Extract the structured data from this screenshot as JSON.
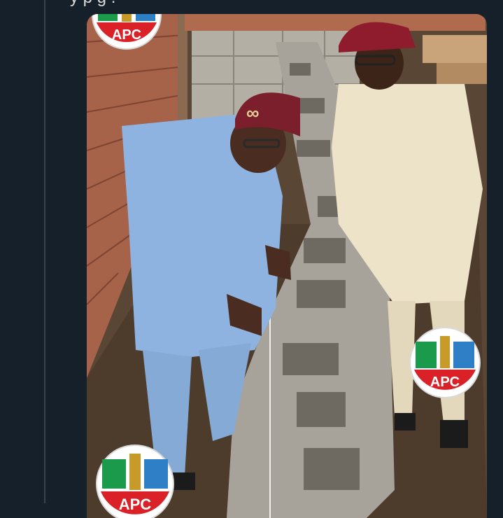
{
  "tweet": {
    "text": "y                      p g     ."
  },
  "photo": {
    "logos": [
      {
        "text": "APC"
      },
      {
        "text": "APC"
      },
      {
        "text": "APC"
      }
    ],
    "colors": {
      "logo_green": "#1c9a4b",
      "logo_red": "#d92127",
      "logo_blue": "#2e7fc6",
      "agbada_blue": "#8eb3e0",
      "cream": "#ede3c8",
      "cap_maroon": "#7a1f2b",
      "hat_red": "#8e1c2c",
      "brick": "#a66349",
      "soil": "#4d3b2c",
      "block": "#a8a39a"
    }
  }
}
